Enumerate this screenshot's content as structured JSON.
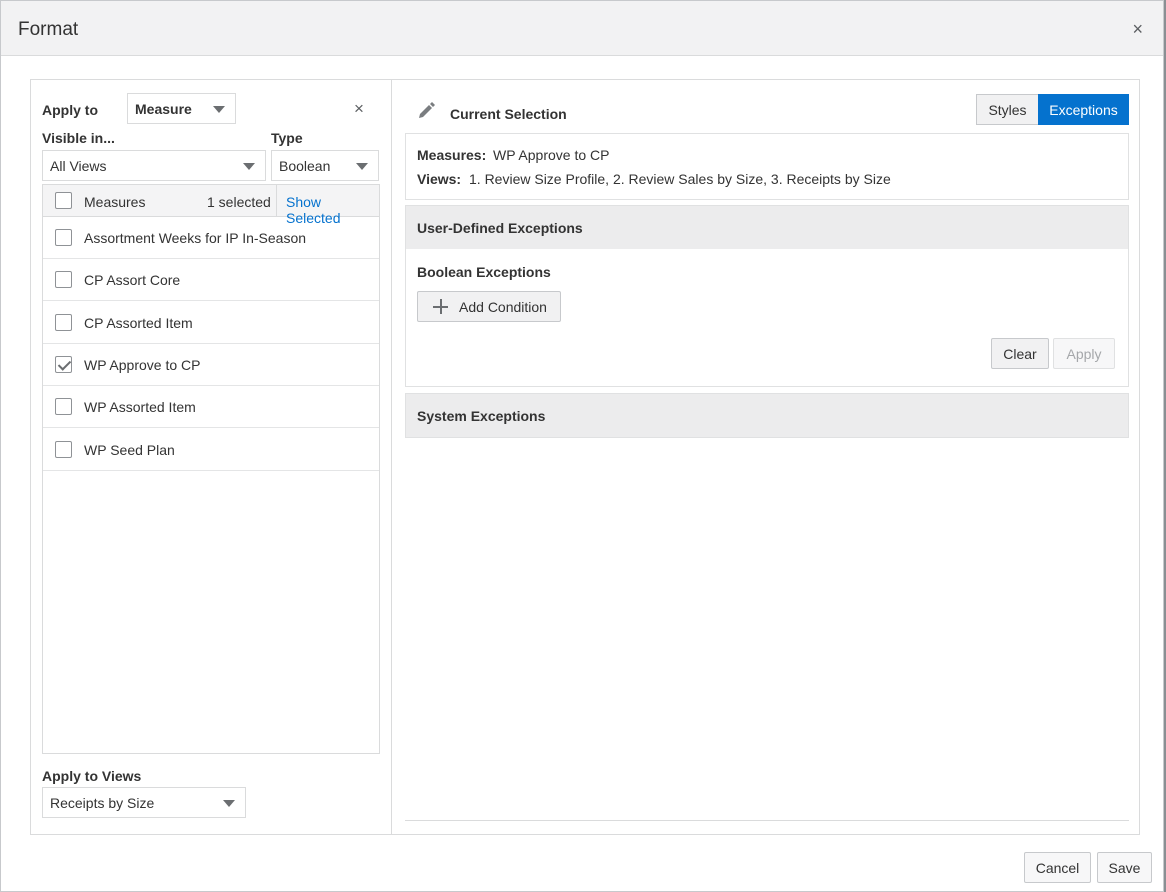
{
  "dialog": {
    "title": "Format",
    "close_icon": "×"
  },
  "left": {
    "apply_to_label": "Apply to",
    "apply_to_value": "Measure",
    "clear_icon": "×",
    "visible_in_label": "Visible in...",
    "visible_in_value": "All Views",
    "type_label": "Type",
    "type_value": "Boolean",
    "list_header": {
      "label": "Measures",
      "count": "1 selected",
      "show_selected": "Show Selected"
    },
    "items": [
      {
        "label": "Assortment Weeks for IP In-Season",
        "checked": false
      },
      {
        "label": "CP Assort Core",
        "checked": false
      },
      {
        "label": "CP Assorted Item",
        "checked": false
      },
      {
        "label": "WP Approve to CP",
        "checked": true
      },
      {
        "label": "WP Assorted Item",
        "checked": false
      },
      {
        "label": "WP Seed Plan",
        "checked": false
      }
    ],
    "apply_to_views_label": "Apply to Views",
    "apply_to_views_value": "Receipts by Size"
  },
  "right": {
    "current_selection_title": "Current Selection",
    "tabs": [
      {
        "label": "Styles",
        "active": false
      },
      {
        "label": "Exceptions",
        "active": true
      }
    ],
    "measures_label": "Measures:",
    "measures_value": "WP Approve to CP",
    "views_label": "Views:",
    "views_value": "1. Review Size Profile, 2. Review Sales by Size, 3. Receipts by Size",
    "user_defined_title": "User-Defined Exceptions",
    "boolean_title": "Boolean Exceptions",
    "add_condition_label": "Add Condition",
    "clear_label": "Clear",
    "apply_label": "Apply",
    "system_title": "System Exceptions"
  },
  "footer": {
    "cancel_label": "Cancel",
    "save_label": "Save"
  },
  "colors": {
    "accent": "#0572ce",
    "link": "#0572ce"
  }
}
